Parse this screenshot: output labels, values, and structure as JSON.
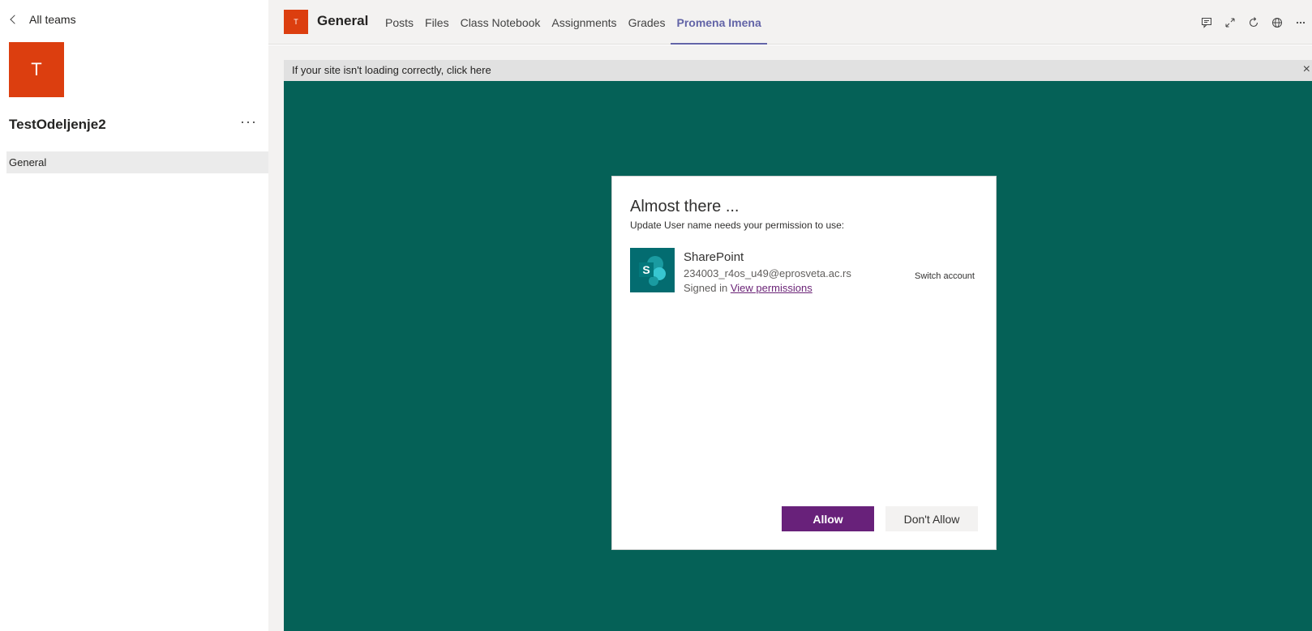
{
  "sidebar": {
    "back_label": "All teams",
    "team_initial": "T",
    "team_name": "TestOdeljenje2",
    "more": "···",
    "channels": [
      {
        "label": "General"
      }
    ]
  },
  "header": {
    "avatar_initial": "T",
    "channel_title": "General",
    "tabs": [
      {
        "label": "Posts"
      },
      {
        "label": "Files"
      },
      {
        "label": "Class Notebook"
      },
      {
        "label": "Assignments"
      },
      {
        "label": "Grades"
      },
      {
        "label": "Promena Imena",
        "active": true
      }
    ],
    "actions": [
      "conversation-icon",
      "expand-icon",
      "reload-icon",
      "globe-icon",
      "more-icon"
    ]
  },
  "notice": {
    "text": "If your site isn't loading correctly, click here",
    "close": "×"
  },
  "dialog": {
    "title": "Almost there ...",
    "subtitle": "Update User name needs your permission to use:",
    "app_name": "SharePoint",
    "app_logo_letter": "S",
    "email": "234003_r4os_u49@eprosveta.ac.rs",
    "signed_in": "Signed in",
    "view_permissions": "View permissions",
    "switch_account": "Switch account",
    "allow": "Allow",
    "dont_allow": "Don't Allow"
  },
  "colors": {
    "team_accent": "#dc3e0f",
    "tab_active": "#6264a7",
    "background_green": "#056157",
    "allow_button": "#68217a",
    "sharepoint": "#036c70"
  }
}
